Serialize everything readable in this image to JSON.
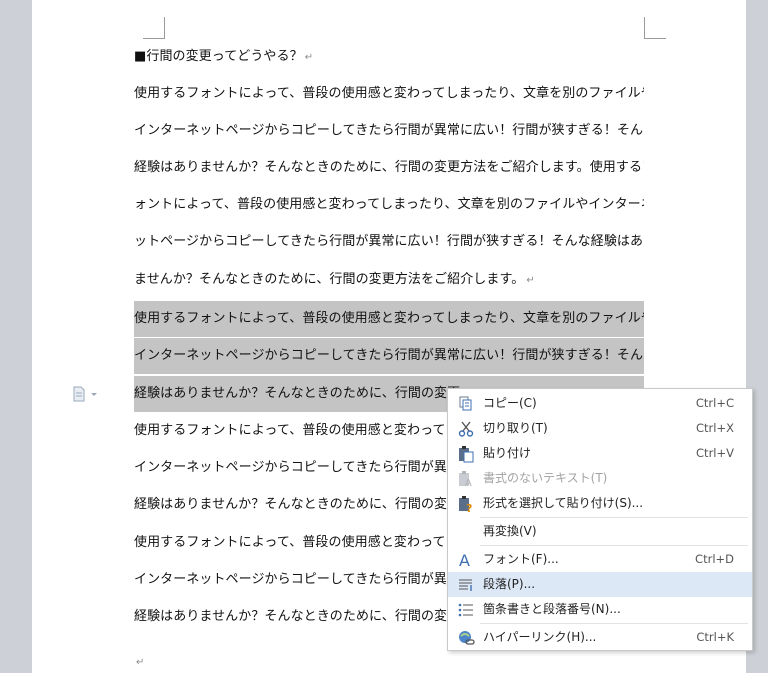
{
  "document": {
    "heading": "■行間の変更ってどうやる？",
    "paragraph_mark": "↵",
    "lines": [
      "使用するフォントによって、普段の使用感と変わってしまったり、文章を別のファイルや",
      "インターネットページからコピーしてきたら行間が異常に広い！行間が狭すぎる！そんな",
      "経験はありませんか？そんなときのために、行間の変更方法をご紹介します。使用するフ",
      "ォントによって、普段の使用感と変わってしまったり、文章を別のファイルやインターネ",
      "ットページからコピーしてきたら行間が異常に広い！行間が狭すぎる！そんな経験はあり",
      "ませんか？そんなときのために、行間の変更方法をご紹介します。",
      "使用するフォントによって、普段の使用感と変わってしまったり、文章を別のファイルや",
      "インターネットページからコピーしてきたら行間が異常に広い！行間が狭すぎる！そんな",
      "経験はありませんか？そんなときのために、行間の変更",
      "使用するフォントによって、普段の使用感と変わってし",
      "インターネットページからコピーしてきたら行間が異常",
      "経験はありませんか？そんなときのために、行間の変更",
      "使用するフォントによって、普段の使用感と変わってし",
      "インターネットページからコピーしてきたら行間が異常",
      "経験はありませんか？そんなときのために、行間の変更"
    ]
  },
  "context_menu": {
    "items": [
      {
        "icon": "copy-icon",
        "label": "コピー(C)",
        "shortcut": "Ctrl+C"
      },
      {
        "icon": "scissors-icon",
        "label": "切り取り(T)",
        "shortcut": "Ctrl+X"
      },
      {
        "icon": "paste-icon",
        "label": "貼り付け",
        "shortcut": "Ctrl+V"
      },
      {
        "icon": "paste-text-icon",
        "label": "書式のないテキスト(T)",
        "shortcut": ""
      },
      {
        "icon": "paste-special-icon",
        "label": "形式を選択して貼り付け(S)...",
        "shortcut": ""
      },
      {
        "icon": "",
        "label": "再変換(V)",
        "shortcut": ""
      },
      {
        "icon": "font-icon",
        "label": "フォント(F)...",
        "shortcut": "Ctrl+D"
      },
      {
        "icon": "paragraph-icon",
        "label": "段落(P)...",
        "shortcut": ""
      },
      {
        "icon": "list-icon",
        "label": "箇条書きと段落番号(N)...",
        "shortcut": ""
      },
      {
        "icon": "hyperlink-icon",
        "label": "ハイパーリンク(H)...",
        "shortcut": "Ctrl+K"
      }
    ]
  },
  "colors": {
    "selection": "#c4c4c4",
    "menu_highlight": "#dde8f6",
    "accent_icon": "#3f6fb0"
  }
}
